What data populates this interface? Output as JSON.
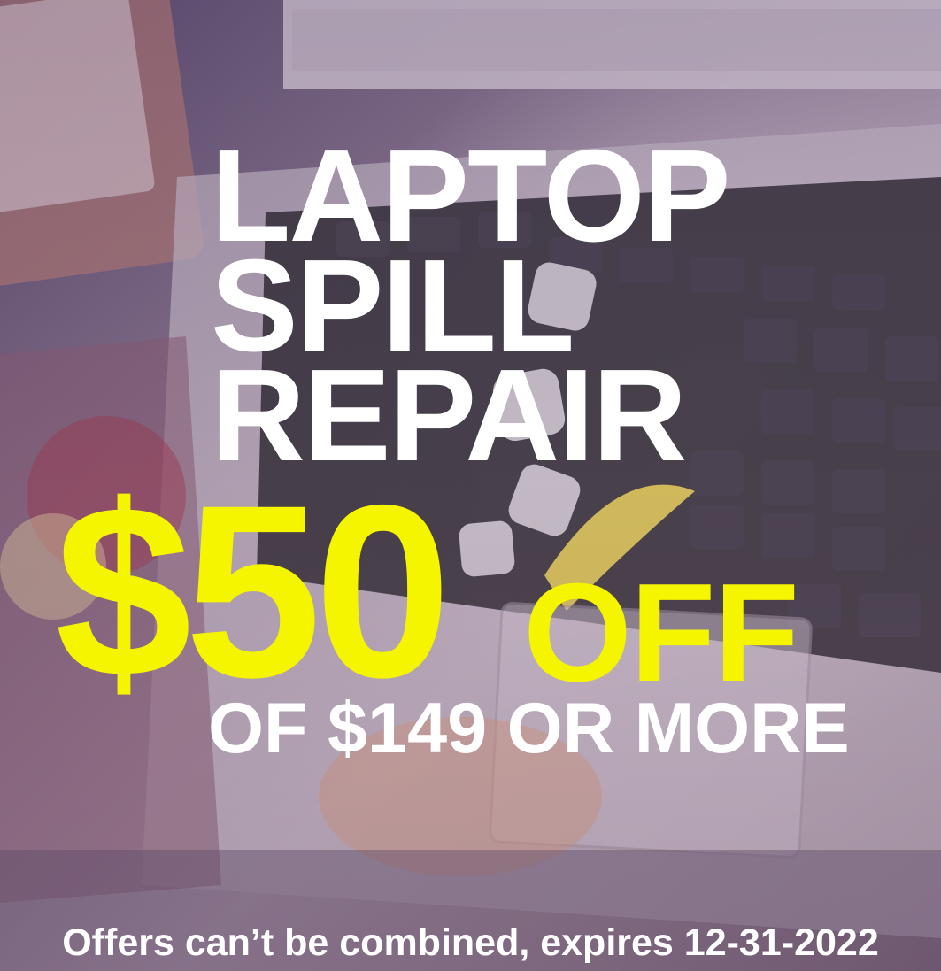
{
  "background": {
    "description_icon": "laptop-keyboard-photo",
    "tint_color": "#6b5a78"
  },
  "headline": {
    "line1": "LAPTOP",
    "line2": "SPILL",
    "line3": "REPAIR"
  },
  "offer": {
    "amount": "$50",
    "off_label": "OFF",
    "condition": "OF $149 OR MORE",
    "accent_color": "#f5f500"
  },
  "fine_print": "Offers can’t be combined, expires 12-31-2022"
}
